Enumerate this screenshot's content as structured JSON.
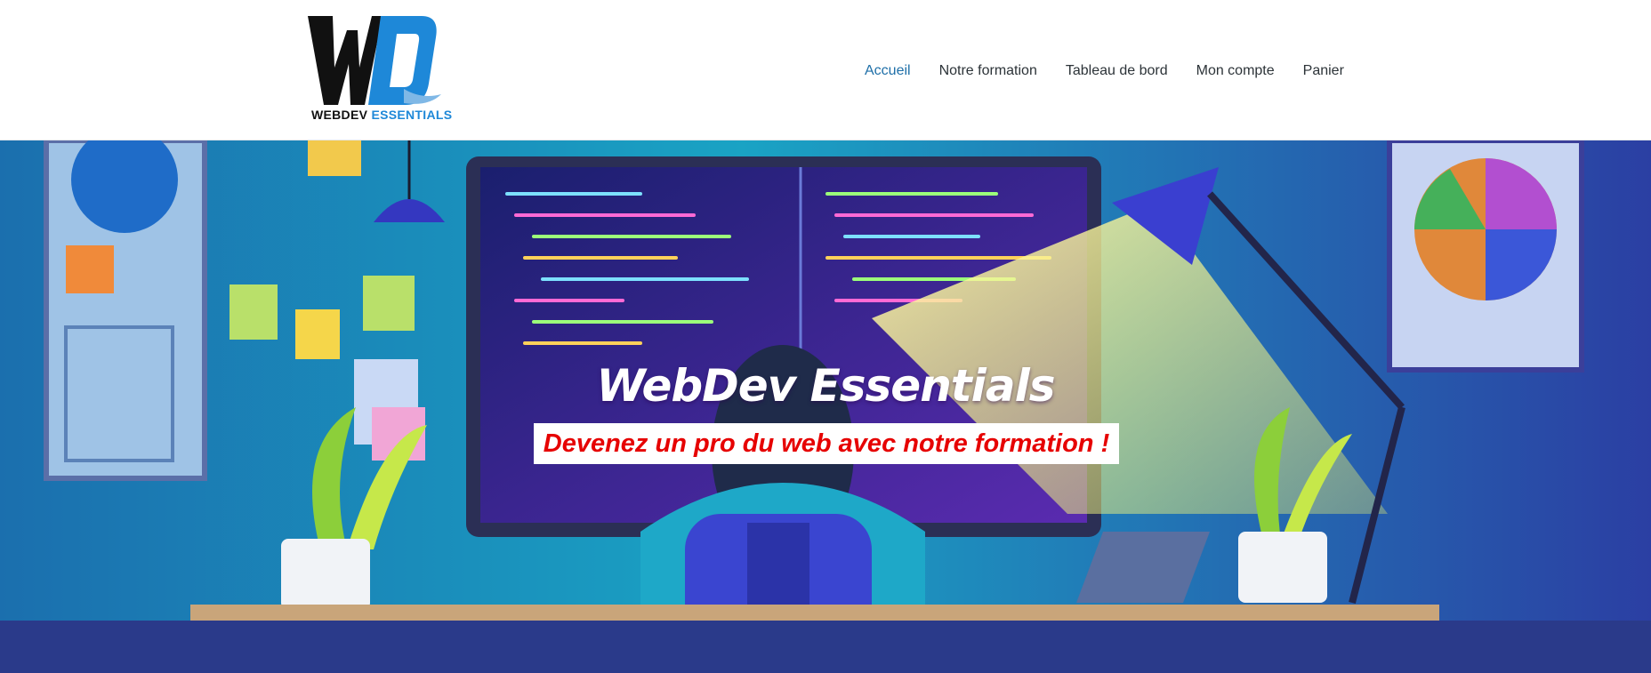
{
  "brand": {
    "logo_text_part1": "WEBDEV",
    "logo_text_part2": "ESSENTIALS",
    "colors": {
      "primary": "#1e88d8",
      "dark": "#111111"
    }
  },
  "nav": {
    "items": [
      {
        "label": "Accueil",
        "active": true
      },
      {
        "label": "Notre formation"
      },
      {
        "label": "Tableau de bord"
      },
      {
        "label": "Mon compte"
      },
      {
        "label": "Panier"
      }
    ],
    "active_color": "#1e6fa8"
  },
  "hero": {
    "title": "WebDev Essentials",
    "subtitle": "Devenez un pro du web avec notre formation !",
    "subtitle_color": "#e60000"
  }
}
